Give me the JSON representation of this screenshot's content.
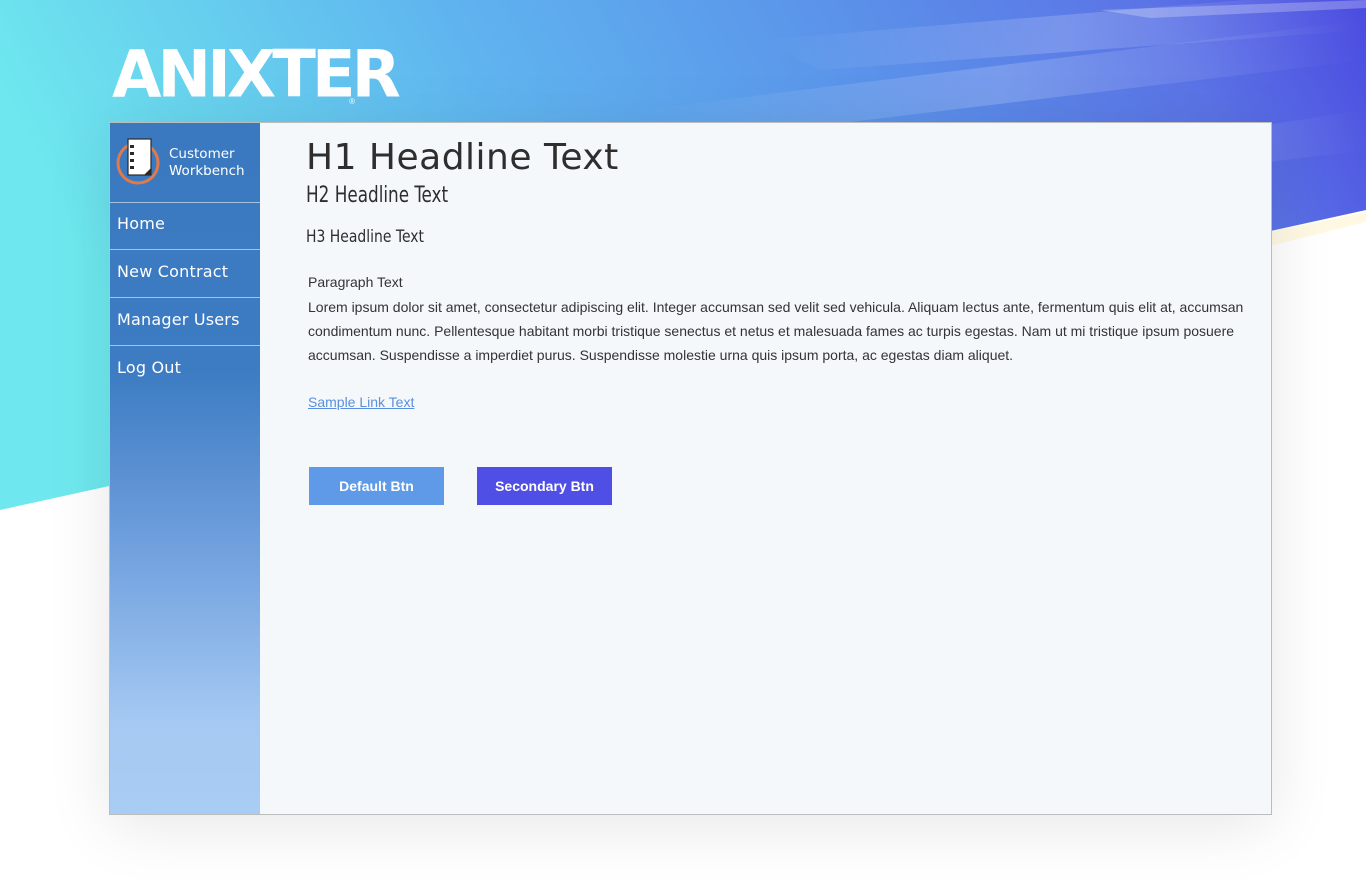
{
  "brand": {
    "logo_text": "ANIXTER",
    "logo_reg": "®",
    "app_name_line1": "Customer",
    "app_name_line2": "Workbench"
  },
  "sidebar": {
    "items": [
      {
        "label": "Home"
      },
      {
        "label": "New Contract"
      },
      {
        "label": "Manager Users"
      },
      {
        "label": "Log Out"
      }
    ]
  },
  "content": {
    "h1": "H1 Headline Text",
    "h2": "H2 Headline Text",
    "h3": "H3 Headline Text",
    "paragraph_label": "Paragraph Text",
    "paragraph": "Lorem ipsum dolor sit amet, consectetur adipiscing elit. Integer accumsan sed velit sed vehicula. Aliquam lectus ante, fermentum quis elit at, accumsan condimentum nunc. Pellentesque habitant morbi tristique senectus et netus et malesuada fames ac turpis egestas. Nam ut mi tristique ipsum posuere accumsan. Suspendisse a imperdiet purus. Suspendisse molestie urna quis ipsum porta, ac egestas diam aliquet.",
    "link_text": "Sample Link Text",
    "default_button": "Default Btn",
    "secondary_button": "Secondary Btn"
  },
  "colors": {
    "sidebar_top": "#3a78bf",
    "sidebar_bottom": "#a9ccf4",
    "default_button": "#5e9ae8",
    "secondary_button": "#4f4fe5",
    "link": "#5b8fdc",
    "banner_left": "#6ee8ee",
    "banner_right": "#4a4ae0"
  }
}
